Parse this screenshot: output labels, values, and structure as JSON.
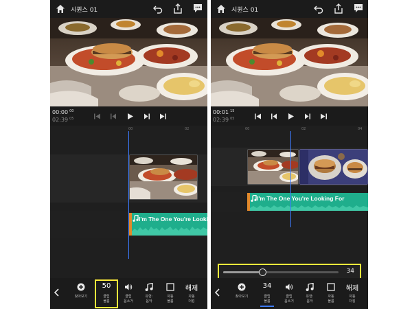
{
  "colors": {
    "accent_yellow": "#ffec3b",
    "playhead_blue": "#3d7bff",
    "audio_green": "#1fae8c",
    "audio_handle_orange": "#e08a2c"
  },
  "left": {
    "title": "시퀀스 01",
    "timecode_current": "00:00",
    "timecode_current_frames": "00",
    "timecode_total": "02:39",
    "timecode_total_frames": "05",
    "ruler": [
      "00",
      "02"
    ],
    "audio_clip_title": "I'm The One You're Looking For",
    "tools": [
      {
        "icon": "plus-circle-icon",
        "label": "찾아보기"
      },
      {
        "value": "50",
        "label": "클립\n볼륨"
      },
      {
        "icon": "speaker-icon",
        "label": "클립\n음소거"
      },
      {
        "icon": "music-note-icon",
        "label": "유형:\n음악"
      },
      {
        "icon": "checkbox-icon",
        "label": "자동\n볼륨"
      },
      {
        "value": "해제",
        "label": "자동\n더킹"
      }
    ]
  },
  "right": {
    "title": "시퀀스 01",
    "timecode_current": "00:01",
    "timecode_current_frames": "15",
    "timecode_total": "02:39",
    "timecode_total_frames": "05",
    "ruler": [
      "00",
      "02",
      "04"
    ],
    "audio_clip_title": "I'm The One You're Looking For",
    "clip_volume": {
      "value": "34",
      "level": 0.34
    },
    "tools": [
      {
        "icon": "plus-circle-icon",
        "label": "찾아보기"
      },
      {
        "value": "34",
        "label": "클립\n볼륨"
      },
      {
        "icon": "speaker-icon",
        "label": "클립\n음소거"
      },
      {
        "icon": "music-note-icon",
        "label": "유형:\n음악"
      },
      {
        "icon": "checkbox-icon",
        "label": "자동\n볼륨"
      },
      {
        "value": "해제",
        "label": "자동\n더킹"
      }
    ]
  }
}
